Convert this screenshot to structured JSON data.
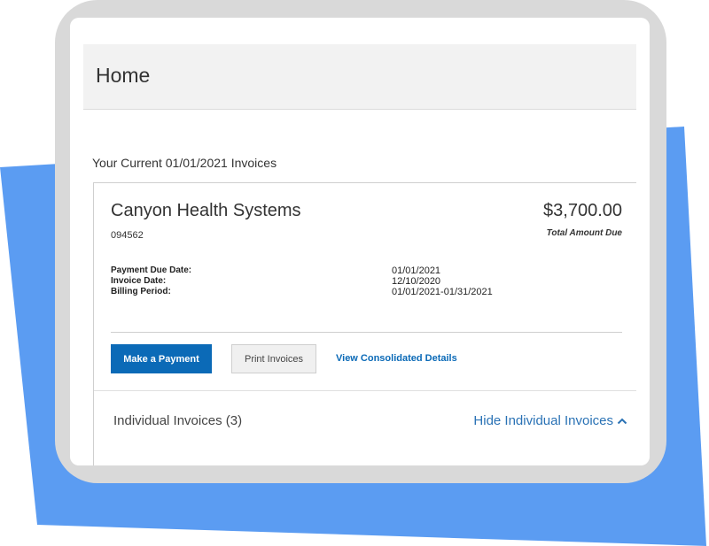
{
  "page": {
    "title": "Home"
  },
  "invoices_section": {
    "heading": "Your Current 01/01/2021 Invoices"
  },
  "invoice_card": {
    "company_name": "Canyon Health Systems",
    "account_number": "094562",
    "total_amount": "$3,700.00",
    "total_amount_label": "Total Amount Due",
    "details": [
      {
        "label": "Payment Due Date:",
        "value": "01/01/2021"
      },
      {
        "label": "Invoice Date:",
        "value": "12/10/2020"
      },
      {
        "label": "Billing Period:",
        "value": "01/01/2021-01/31/2021"
      }
    ],
    "actions": {
      "make_payment_label": "Make a Payment",
      "print_invoices_label": "Print Invoices",
      "view_consolidated_label": "View Consolidated Details"
    },
    "individual_invoices": {
      "label": "Individual Invoices (3)",
      "toggle_label": "Hide Individual Invoices"
    }
  },
  "colors": {
    "primary": "#0b6ab7",
    "link": "#2a72b5",
    "backdrop": "#5b9cf2",
    "device_frame": "#d9d9d9"
  },
  "icons": {
    "toggle": "chevron-up-icon"
  }
}
